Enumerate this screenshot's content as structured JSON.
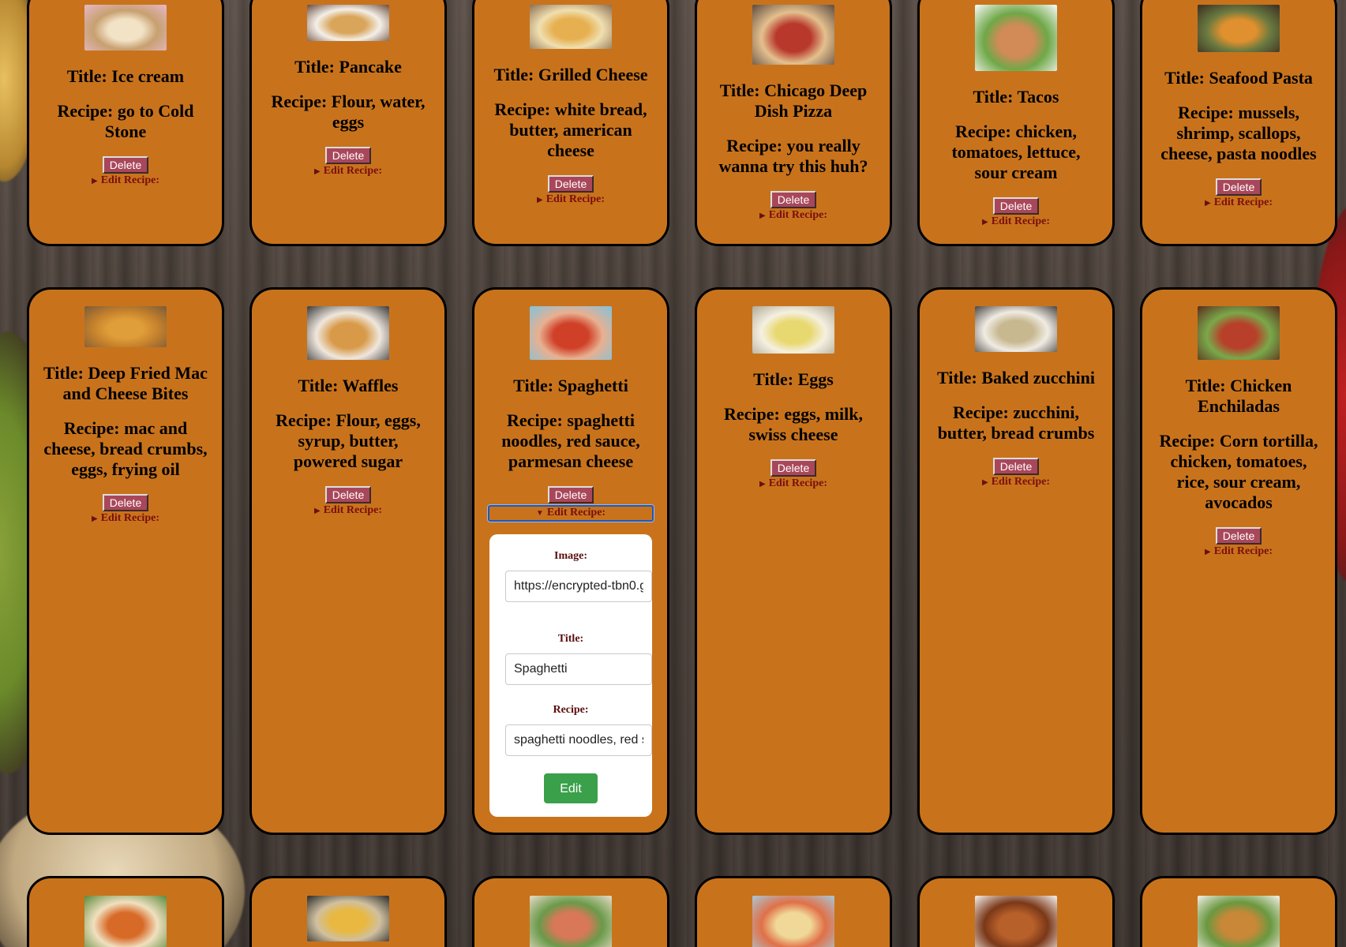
{
  "delete_label": "Delete",
  "edit_summary_label": "Edit Recipe:",
  "form": {
    "image_label": "Image:",
    "title_label": "Title:",
    "recipe_label": "Recipe:",
    "image_value": "https://encrypted-tbn0.g",
    "title_value": "Spaghetti",
    "recipe_value": "spaghetti noodles, red s",
    "submit_label": "Edit"
  },
  "cards": [
    {
      "title": "Title: Ice cream",
      "recipe": "Recipe: go to Cold Stone",
      "colors": [
        "#e9b8c8",
        "#f2e2c6",
        "#c7a070"
      ]
    },
    {
      "title": "Title: Pancake",
      "recipe": "Recipe: Flour, water, eggs",
      "colors": [
        "#6b4a3a",
        "#d9a55a",
        "#f3efe9"
      ]
    },
    {
      "title": "Title: Grilled Cheese",
      "recipe": "Recipe: white bread, butter, american cheese",
      "colors": [
        "#8b6e52",
        "#e6b050",
        "#f0dfb0"
      ]
    },
    {
      "title": "Title: Chicago Deep Dish Pizza",
      "recipe": "Recipe: you really wanna try this huh?",
      "colors": [
        "#5c4a40",
        "#b8382c",
        "#e4c08e"
      ]
    },
    {
      "title": "Title: Tacos",
      "recipe": "Recipe: chicken, tomatoes, lettuce, sour cream",
      "colors": [
        "#fafafa",
        "#d28a56",
        "#6fa848"
      ]
    },
    {
      "title": "Title: Seafood Pasta",
      "recipe": "Recipe: mussels, shrimp, scallops, cheese, pasta noodles",
      "colors": [
        "#3a2c22",
        "#e0902e",
        "#6a7a40"
      ]
    },
    {
      "title": "Title: Deep Fried Mac and Cheese Bites",
      "recipe": "Recipe: mac and cheese, bread crumbs, eggs, frying oil",
      "colors": [
        "#7a5a38",
        "#e09e3a",
        "#c8832c"
      ]
    },
    {
      "title": "Title: Waffles",
      "recipe": "Recipe: Flour, eggs, syrup, butter, powered sugar",
      "colors": [
        "#3a3a3a",
        "#d89a48",
        "#efe7de"
      ]
    },
    {
      "title": "Title: Spaghetti",
      "recipe": "Recipe: spaghetti noodles, red sauce, parmesan cheese",
      "colors": [
        "#7ec3e0",
        "#d04028",
        "#e8b090"
      ]
    },
    {
      "title": "Title: Eggs",
      "recipe": "Recipe: eggs, milk, swiss cheese",
      "colors": [
        "#b0a898",
        "#e8d870",
        "#f5f0e0"
      ]
    },
    {
      "title": "Title: Baked zucchini",
      "recipe": "Recipe: zucchini, butter, bread crumbs",
      "colors": [
        "#4a4440",
        "#c8b890",
        "#f0ece4"
      ]
    },
    {
      "title": "Title: Chicken Enchiladas",
      "recipe": "Recipe: Corn tortilla, chicken, tomatoes, rice, sour cream, avocados",
      "colors": [
        "#5a2a1c",
        "#b8402a",
        "#7aa84a"
      ]
    },
    {
      "title": "",
      "recipe": "",
      "colors": [
        "#5a8a3a",
        "#d86a28",
        "#f0e0c0"
      ]
    },
    {
      "title": "",
      "recipe": "",
      "colors": [
        "#2a2a2a",
        "#e8b840",
        "#d0c0a0"
      ]
    },
    {
      "title": "",
      "recipe": "",
      "colors": [
        "#e8dcc8",
        "#d87858",
        "#6a9a4a"
      ]
    },
    {
      "title": "",
      "recipe": "",
      "colors": [
        "#a8c8d8",
        "#f0d898",
        "#e07048"
      ]
    },
    {
      "title": "",
      "recipe": "",
      "colors": [
        "#f8f4f0",
        "#b8602a",
        "#7a3818"
      ]
    },
    {
      "title": "",
      "recipe": "",
      "colors": [
        "#f4f0e8",
        "#c88838",
        "#6a9840"
      ]
    }
  ]
}
